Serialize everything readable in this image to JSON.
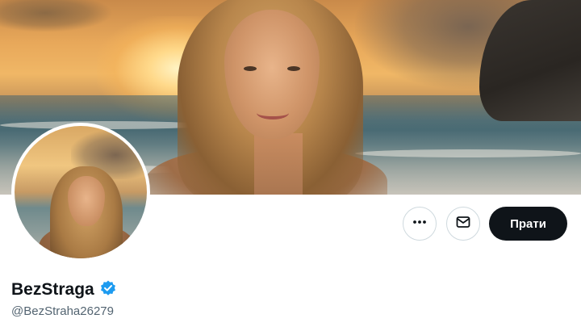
{
  "profile": {
    "display_name": "BezStraga",
    "handle": "@BezStraha26279",
    "verified": true,
    "verified_color": "#1d9bf0"
  },
  "actions": {
    "more_icon": "more-horizontal-icon",
    "message_icon": "envelope-icon",
    "follow_label": "Прати"
  },
  "colors": {
    "follow_bg": "#0f1419",
    "follow_text": "#ffffff",
    "name_text": "#0f1419",
    "handle_text": "#536471"
  }
}
